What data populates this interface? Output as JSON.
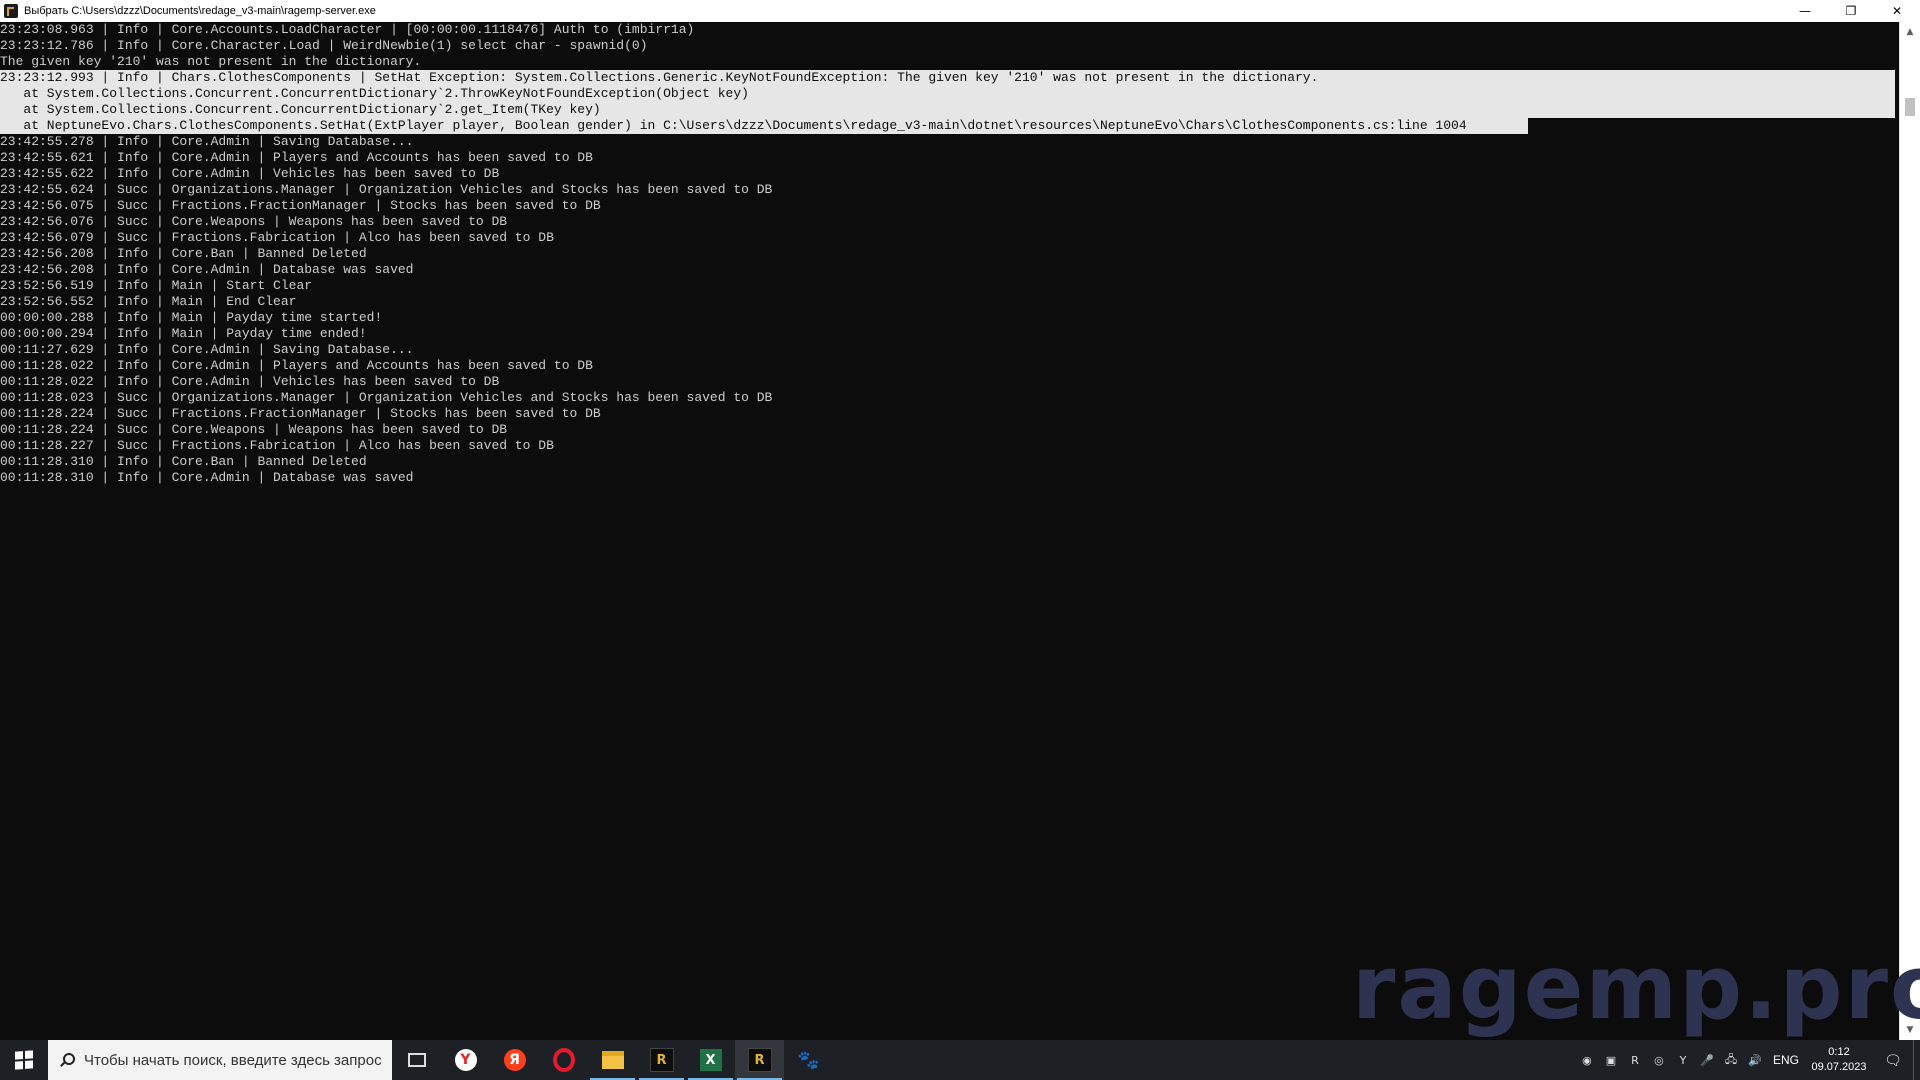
{
  "window": {
    "title": "Выбрать C:\\Users\\dzzz\\Documents\\redage_v3-main\\ragemp-server.exe",
    "minimize": "—",
    "restore": "❐",
    "close": "✕"
  },
  "console": {
    "lines": [
      "23:23:08.963 | Info | Core.Accounts.LoadCharacter | [00:00:00.1118476] Auth to (imbirr1a)",
      "23:23:12.786 | Info | Core.Character.Load | WeirdNewbie(1) select char - spawnid(0)",
      "The given key '210' was not present in the dictionary.",
      "23:23:12.993 | Info | Chars.ClothesComponents | SetHat Exception: System.Collections.Generic.KeyNotFoundException: The given key '210' was not present in the dictionary.",
      "   at System.Collections.Concurrent.ConcurrentDictionary`2.ThrowKeyNotFoundException(Object key)",
      "   at System.Collections.Concurrent.ConcurrentDictionary`2.get_Item(TKey key)",
      "   at NeptuneEvo.Chars.ClothesComponents.SetHat(ExtPlayer player, Boolean gender) in C:\\Users\\dzzz\\Documents\\redage_v3-main\\dotnet\\resources\\NeptuneEvo\\Chars\\ClothesComponents.cs:line 1004",
      "23:42:55.278 | Info | Core.Admin | Saving Database...",
      "23:42:55.621 | Info | Core.Admin | Players and Accounts has been saved to DB",
      "23:42:55.622 | Info | Core.Admin | Vehicles has been saved to DB",
      "23:42:55.624 | Succ | Organizations.Manager | Organization Vehicles and Stocks has been saved to DB",
      "23:42:56.075 | Succ | Fractions.FractionManager | Stocks has been saved to DB",
      "23:42:56.076 | Succ | Core.Weapons | Weapons has been saved to DB",
      "23:42:56.079 | Succ | Fractions.Fabrication | Alco has been saved to DB",
      "23:42:56.208 | Info | Core.Ban | Banned Deleted",
      "23:42:56.208 | Info | Core.Admin | Database was saved",
      "23:52:56.519 | Info | Main | Start Clear",
      "23:52:56.552 | Info | Main | End Clear",
      "00:00:00.288 | Info | Main | Payday time started!",
      "00:00:00.294 | Info | Main | Payday time ended!",
      "00:11:27.629 | Info | Core.Admin | Saving Database...",
      "00:11:28.022 | Info | Core.Admin | Players and Accounts has been saved to DB",
      "00:11:28.022 | Info | Core.Admin | Vehicles has been saved to DB",
      "00:11:28.023 | Succ | Organizations.Manager | Organization Vehicles and Stocks has been saved to DB",
      "00:11:28.224 | Succ | Fractions.FractionManager | Stocks has been saved to DB",
      "00:11:28.224 | Succ | Core.Weapons | Weapons has been saved to DB",
      "00:11:28.227 | Succ | Fractions.Fabrication | Alco has been saved to DB",
      "00:11:28.310 | Info | Core.Ban | Banned Deleted",
      "00:11:28.310 | Info | Core.Admin | Database was saved"
    ]
  },
  "scrollbar": {
    "up": "▲",
    "down": "▼"
  },
  "watermark": "ragemp.pro",
  "taskbar": {
    "search_placeholder": "Чтобы начать поиск, введите здесь запрос",
    "apps": [
      {
        "icon": "task-view-icon",
        "glyph": ""
      },
      {
        "icon": "yandex-browser-icon",
        "glyph": "Y"
      },
      {
        "icon": "yandex-icon",
        "glyph": "Я"
      },
      {
        "icon": "opera-icon",
        "glyph": ""
      },
      {
        "icon": "file-explorer-icon",
        "glyph": ""
      },
      {
        "icon": "ragemp-icon",
        "glyph": "R"
      },
      {
        "icon": "excel-icon",
        "glyph": "X"
      },
      {
        "icon": "ragemp-server-icon",
        "glyph": "R"
      },
      {
        "icon": "paw-icon",
        "glyph": "🐾"
      }
    ],
    "tray": {
      "icons": [
        "discord-icon",
        "nvidia-icon",
        "ragemp-tray-icon",
        "steam-icon",
        "yandex-tray-icon",
        "microphone-icon",
        "network-icon",
        "volume-icon"
      ],
      "tray_glyphs": [
        "◉",
        "▣",
        "R",
        "◎",
        "Y",
        "🎤",
        "🖧",
        "🔊"
      ],
      "language": "ENG",
      "time": "0:12",
      "date": "09.07.2023",
      "notifications": "🗨"
    }
  }
}
